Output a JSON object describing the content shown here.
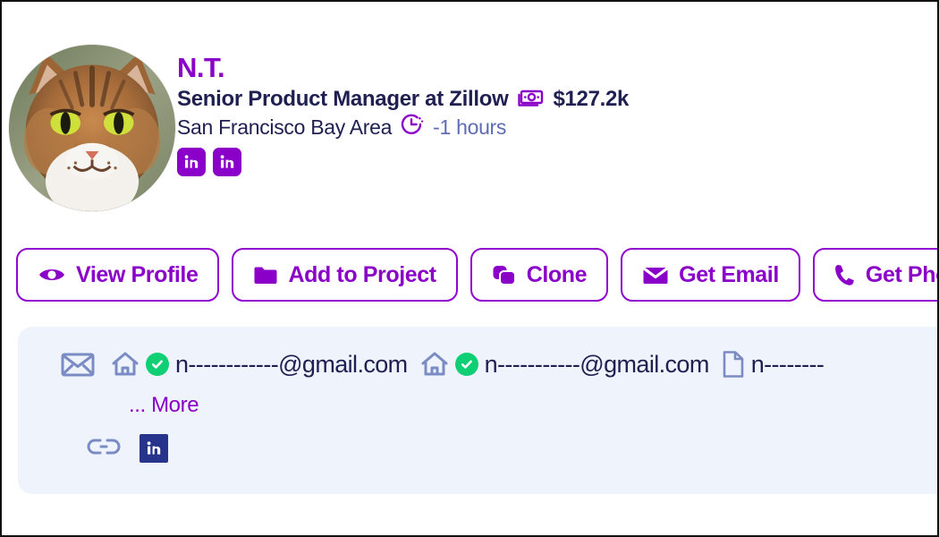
{
  "profile": {
    "avatar_alt": "cat-profile-photo",
    "name": "N.T.",
    "job_title": "Senior Product Manager at Zillow",
    "salary": "$127.2k",
    "salary_icon": "money-icon",
    "location": "San Francisco Bay Area",
    "timezone": "-1 hours",
    "timezone_icon": "clock-icon",
    "social_badges": [
      {
        "name": "linkedin-badge-1",
        "label": "in",
        "color": "#8a00c8"
      },
      {
        "name": "linkedin-badge-2",
        "label": "in",
        "color": "#8a00c8"
      }
    ]
  },
  "actions": [
    {
      "name": "view-profile-button",
      "label": "View Profile",
      "icon": "eye-icon"
    },
    {
      "name": "add-to-project-button",
      "label": "Add to Project",
      "icon": "folder-icon"
    },
    {
      "name": "clone-button",
      "label": "Clone",
      "icon": "copy-icon"
    },
    {
      "name": "get-email-button",
      "label": "Get Email",
      "icon": "envelope-icon"
    },
    {
      "name": "get-phone-button",
      "label": "Get Phone",
      "icon": "phone-icon"
    }
  ],
  "contact": {
    "row_icon": "envelope-icon",
    "entries": [
      {
        "icon": "home-icon",
        "verified": true,
        "value": "n------------@gmail.com"
      },
      {
        "icon": "home-icon",
        "verified": true,
        "value": "n-----------@gmail.com"
      },
      {
        "icon": "document-icon",
        "verified": false,
        "value": "n--------"
      }
    ],
    "more_label": "... More",
    "links_icon": "link-icon",
    "link_badges": [
      {
        "name": "linkedin-link-badge",
        "label": "in",
        "color": "#26348b"
      }
    ]
  },
  "colors": {
    "accent_purple": "#8a00c8",
    "border_purple": "#9105d1",
    "navy_text": "#1f1f52",
    "timezone_blue": "#5d6cb4",
    "verified_green": "#0fcf74",
    "panel_bg": "#eff3fb",
    "linkedin_dark": "#26348b"
  }
}
